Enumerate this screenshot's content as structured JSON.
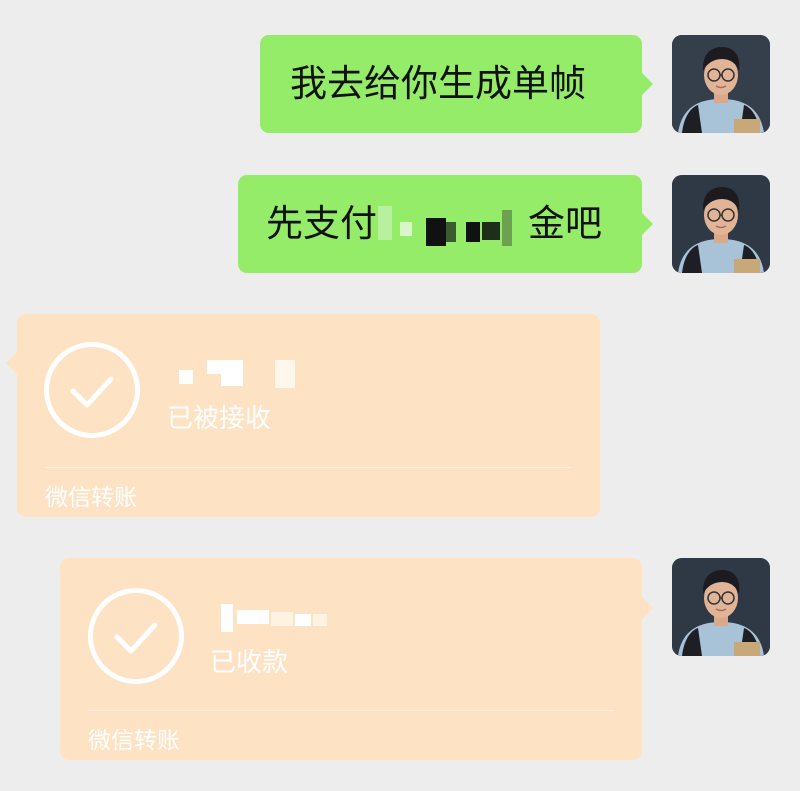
{
  "messages": [
    {
      "type": "text",
      "direction": "outgoing",
      "text": "我去给你生成单帧"
    },
    {
      "type": "text",
      "direction": "outgoing",
      "text": "先支付",
      "text_end": "金吧",
      "redacted": true
    },
    {
      "type": "transfer",
      "direction": "incoming",
      "amount_redacted": true,
      "status": "已被接收",
      "footer": "微信转账"
    },
    {
      "type": "transfer",
      "direction": "outgoing",
      "amount_redacted": true,
      "status": "已收款",
      "footer": "微信转账"
    }
  ],
  "colors": {
    "background": "#ededed",
    "outgoing_bubble": "#95ec69",
    "transfer_card": "#fde2c4",
    "text": "#111111",
    "transfer_text": "#ffffff"
  },
  "icons": {
    "transfer_status": "check-circle-icon",
    "avatar": "user-avatar"
  }
}
